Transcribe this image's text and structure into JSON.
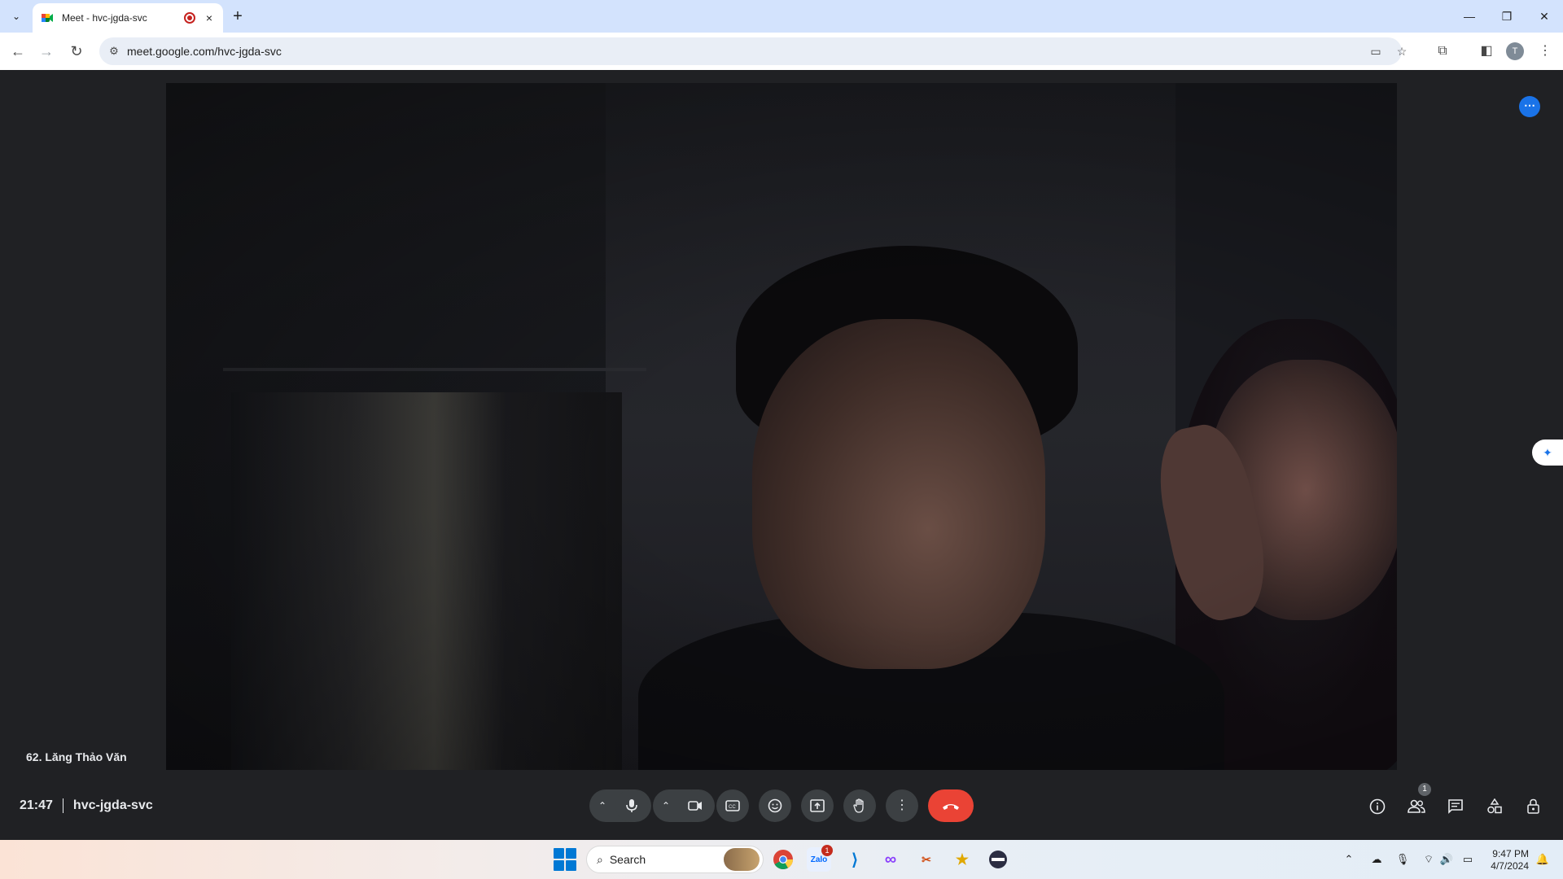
{
  "browser": {
    "tab_title": "Meet - hvc-jgda-svc",
    "url": "meet.google.com/hvc-jgda-svc",
    "new_tab_symbol": "+",
    "tab_close_symbol": "×",
    "profile_initial": "T"
  },
  "meet": {
    "participant_name": "62. Lăng Thảo Văn",
    "time": "21:47",
    "meeting_code": "hvc-jgda-svc",
    "people_count": "1",
    "accent_color": "#1a73e8",
    "end_call_color": "#ea4335"
  },
  "taskbar": {
    "search_label": "Search",
    "chat_badge": "1",
    "clock_time": "9:47 PM",
    "clock_date": "4/7/2024"
  }
}
